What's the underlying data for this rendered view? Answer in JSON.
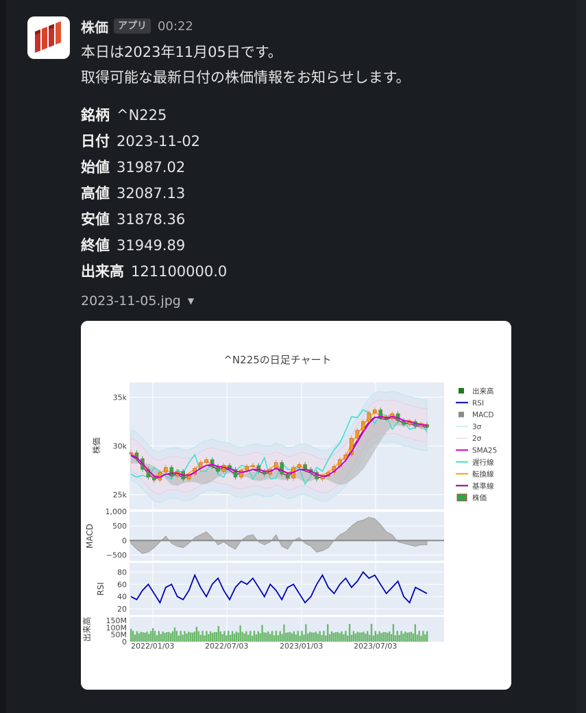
{
  "message": {
    "sender": "株価",
    "badge": "アプリ",
    "time": "00:22",
    "lines": [
      "本日は2023年11月05日です。",
      "取得可能な最新日付の株価情報をお知らせします。"
    ],
    "fields": [
      {
        "label": "銘柄",
        "value": "^N225"
      },
      {
        "label": "日付",
        "value": "2023-11-02"
      },
      {
        "label": "始値",
        "value": "31987.02"
      },
      {
        "label": "高値",
        "value": "32087.13"
      },
      {
        "label": "安値",
        "value": "31878.36"
      },
      {
        "label": "終値",
        "value": "31949.89"
      },
      {
        "label": "出来高",
        "value": "121100000.0"
      }
    ],
    "attachment": {
      "filename": "2023-11-05.jpg"
    }
  },
  "colors": {
    "price_up": "#e8a020",
    "price_down": "#2ba84a",
    "sma25": "#cc00cc",
    "rsi": "#0000b4",
    "macd": "#999999",
    "chikou": "#40e0d0",
    "tenkan": "#ffa500",
    "kijun": "#800080",
    "volume": "#6bb86b",
    "plot_bg": "#e5ecf6"
  },
  "chart_data": {
    "type": "line",
    "title": "^N225の日足チャート",
    "x_ticks": [
      "2022/01/03",
      "2022/07/03",
      "2023/01/03",
      "2023/07/03"
    ],
    "legend": [
      "出来高",
      "RSI",
      "MACD",
      "3σ",
      "2σ",
      "SMA25",
      "遅行線",
      "転換線",
      "基準線",
      "株価"
    ],
    "legend_position": "right",
    "panels": [
      {
        "name": "price",
        "ylabel": "株価",
        "y_ticks": [
          "35k",
          "30k",
          "25k"
        ],
        "ylim": [
          23500,
          36500
        ],
        "series": [
          {
            "name": "株価",
            "values": [
              29300,
              28700,
              27600,
              26800,
              26500,
              27300,
              27800,
              26900,
              27400,
              26600,
              27100,
              27700,
              28300,
              28600,
              27900,
              27400,
              28000,
              27600,
              26800,
              27500,
              27900,
              28000,
              27400,
              27100,
              27600,
              28300,
              27100,
              26700,
              27800,
              28100,
              27600,
              27300,
              26600,
              26900,
              27300,
              27900,
              28600,
              29100,
              30800,
              31600,
              32500,
              33400,
              33700,
              32900,
              32800,
              33300,
              32600,
              32200,
              32500,
              32000,
              32200,
              31900
            ]
          },
          {
            "name": "SMA25",
            "values": [
              29100,
              28800,
              28200,
              27500,
              26900,
              26800,
              27100,
              27200,
              27200,
              27000,
              27000,
              27300,
              27700,
              28000,
              28100,
              27900,
              27800,
              27700,
              27400,
              27300,
              27400,
              27600,
              27600,
              27400,
              27400,
              27700,
              27500,
              27200,
              27300,
              27600,
              27600,
              27400,
              27100,
              26900,
              27000,
              27400,
              27900,
              28500,
              29400,
              30400,
              31400,
              32300,
              32900,
              33000,
              32900,
              33000,
              32900,
              32600,
              32500,
              32300,
              32200,
              32100
            ]
          }
        ]
      },
      {
        "name": "macd",
        "ylabel": "MACD",
        "y_ticks": [
          "1,000",
          "500",
          "0",
          "−500"
        ],
        "ylim": [
          -700,
          1000
        ],
        "series": [
          {
            "name": "MACD",
            "values": [
              -100,
              -300,
              -450,
              -400,
              -250,
              -50,
              150,
              -100,
              -200,
              -250,
              -100,
              100,
              200,
              300,
              100,
              -150,
              -50,
              -200,
              -300,
              0,
              150,
              200,
              -50,
              -150,
              -50,
              200,
              -200,
              -300,
              0,
              100,
              -100,
              -200,
              -400,
              -350,
              -250,
              0,
              200,
              300,
              500,
              650,
              700,
              800,
              750,
              550,
              300,
              200,
              -50,
              -100,
              -150,
              -200,
              -150,
              -150
            ]
          }
        ]
      },
      {
        "name": "rsi",
        "ylabel": "RSI",
        "y_ticks": [
          "80",
          "60",
          "40",
          "20"
        ],
        "ylim": [
          10,
          95
        ],
        "series": [
          {
            "name": "RSI",
            "values": [
              40,
              35,
              50,
              60,
              45,
              30,
              55,
              60,
              40,
              35,
              50,
              75,
              55,
              40,
              60,
              70,
              50,
              35,
              55,
              65,
              60,
              70,
              55,
              40,
              60,
              50,
              35,
              55,
              60,
              45,
              30,
              40,
              60,
              75,
              55,
              45,
              60,
              70,
              55,
              65,
              80,
              70,
              75,
              60,
              45,
              55,
              65,
              40,
              30,
              55,
              50,
              45
            ]
          }
        ]
      },
      {
        "name": "volume",
        "ylabel": "出来高",
        "y_ticks": [
          "150M",
          "100M",
          "50M",
          "0"
        ],
        "ylim": [
          0,
          175000000
        ]
      }
    ]
  }
}
